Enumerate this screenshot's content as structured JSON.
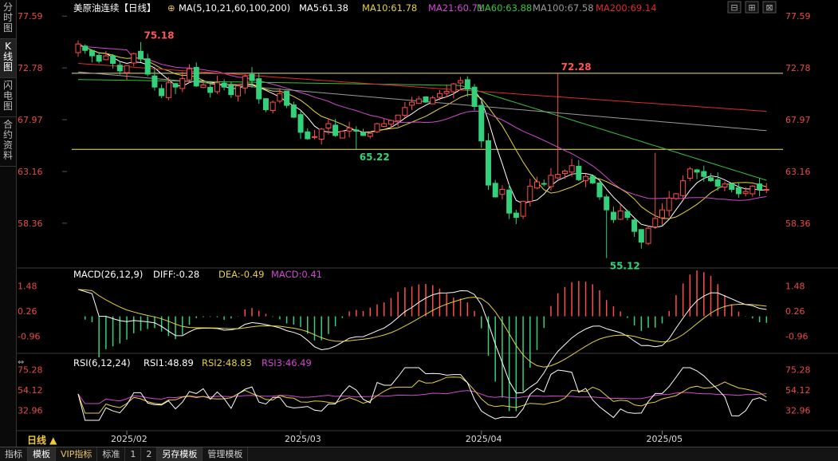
{
  "left_tabs": [
    "分时图",
    "K线图",
    "闪电图",
    "合约资料"
  ],
  "active_left_tab": 1,
  "bottom_tabs": [
    "指标",
    "模板",
    "VIP指标",
    "标准",
    "1",
    "2",
    "另存模板",
    "管理模板"
  ],
  "period_label": "日线 ▲",
  "colors": {
    "up": "#ff4d4d",
    "down": "#33d17a",
    "ma5": "#ffffff",
    "ma10": "#e6d23a",
    "ma21": "#d448d4",
    "ma60": "#37c43a",
    "ma100": "#9a9a9a",
    "ma200": "#e02b2b",
    "hline": "#f2e27a",
    "axis": "#e84a4a",
    "bg": "#000000"
  },
  "price_panel": {
    "title": "美原油连续【日线】",
    "ma_label": "MA(5,10,21,60,100,200)",
    "ma_values": [
      {
        "name": "MA5",
        "value": "61.38"
      },
      {
        "name": "MA10",
        "value": "61.78"
      },
      {
        "name": "MA21",
        "value": "60.71"
      },
      {
        "name": "MA60",
        "value": "63.88"
      },
      {
        "name": "MA100",
        "value": "67.58"
      },
      {
        "name": "MA200",
        "value": "69.14"
      }
    ],
    "y_ticks": [
      "77.59",
      "72.78",
      "67.97",
      "63.16",
      "58.36"
    ],
    "annotations": [
      {
        "text": "75.18",
        "at": "high",
        "index": 9,
        "color": "#ff5555"
      },
      {
        "text": "72.28",
        "at": "high",
        "index": 69,
        "color": "#ff5555"
      },
      {
        "text": "65.22",
        "at": "low",
        "index": 40,
        "color": "#33d17a"
      },
      {
        "text": "55.12",
        "at": "low",
        "index": 76,
        "color": "#33d17a"
      }
    ],
    "horizontal_lines": [
      72.28,
      65.22
    ]
  },
  "macd_panel": {
    "label": "MACD(26,12,9)",
    "diff": "DIFF:-0.28",
    "dea": "DEA:-0.49",
    "macd": "MACD:0.41",
    "y_ticks": [
      "1.48",
      "0.26",
      "-0.96"
    ]
  },
  "rsi_panel": {
    "label": "RSI(6,12,24)",
    "rsi1": "RSI1:48.89",
    "rsi2": "RSI2:48.83",
    "rsi3": "RSI3:46.49",
    "y_ticks": [
      "75.28",
      "54.12",
      "32.96"
    ]
  },
  "x_ticks": [
    {
      "label": "2025/02",
      "index": 7
    },
    {
      "label": "2025/03",
      "index": 32
    },
    {
      "label": "2025/04",
      "index": 58
    },
    {
      "label": "2025/05",
      "index": 84
    }
  ],
  "chart_data": {
    "type": "candlestick",
    "title": "美原油连续【日线】",
    "ylim": [
      54.5,
      77.9
    ],
    "closes": [
      75.0,
      74.4,
      73.9,
      73.4,
      73.9,
      73.2,
      72.5,
      73.0,
      74.1,
      73.6,
      72.2,
      71.0,
      70.2,
      71.4,
      71.0,
      71.8,
      72.7,
      71.1,
      71.2,
      70.5,
      71.4,
      71.0,
      70.3,
      71.1,
      72.0,
      71.6,
      69.9,
      68.9,
      69.6,
      70.4,
      69.3,
      68.2,
      66.8,
      66.2,
      66.4,
      67.1,
      67.6,
      66.5,
      66.9,
      67.2,
      66.9,
      66.5,
      66.7,
      67.6,
      67.6,
      67.9,
      68.4,
      69.1,
      69.6,
      69.9,
      69.6,
      70.0,
      70.4,
      70.6,
      71.3,
      71.6,
      70.8,
      69.2,
      66.0,
      61.9,
      60.8,
      61.5,
      59.3,
      58.9,
      60.4,
      61.8,
      62.2,
      62.0,
      62.8,
      62.9,
      63.2,
      63.7,
      62.4,
      62.7,
      62.1,
      60.8,
      59.6,
      58.7,
      59.5,
      58.9,
      57.6,
      56.6,
      57.9,
      58.8,
      59.6,
      60.7,
      61.1,
      62.3,
      63.4,
      63.1,
      62.7,
      62.3,
      61.8,
      62.0,
      61.5,
      61.1,
      61.3,
      61.8,
      61.5,
      61.5
    ],
    "highs_lows": "approximate, derived from closes",
    "series": [
      {
        "name": "MA5"
      },
      {
        "name": "MA10"
      },
      {
        "name": "MA21"
      },
      {
        "name": "MA60"
      },
      {
        "name": "MA100"
      },
      {
        "name": "MA200"
      }
    ]
  }
}
